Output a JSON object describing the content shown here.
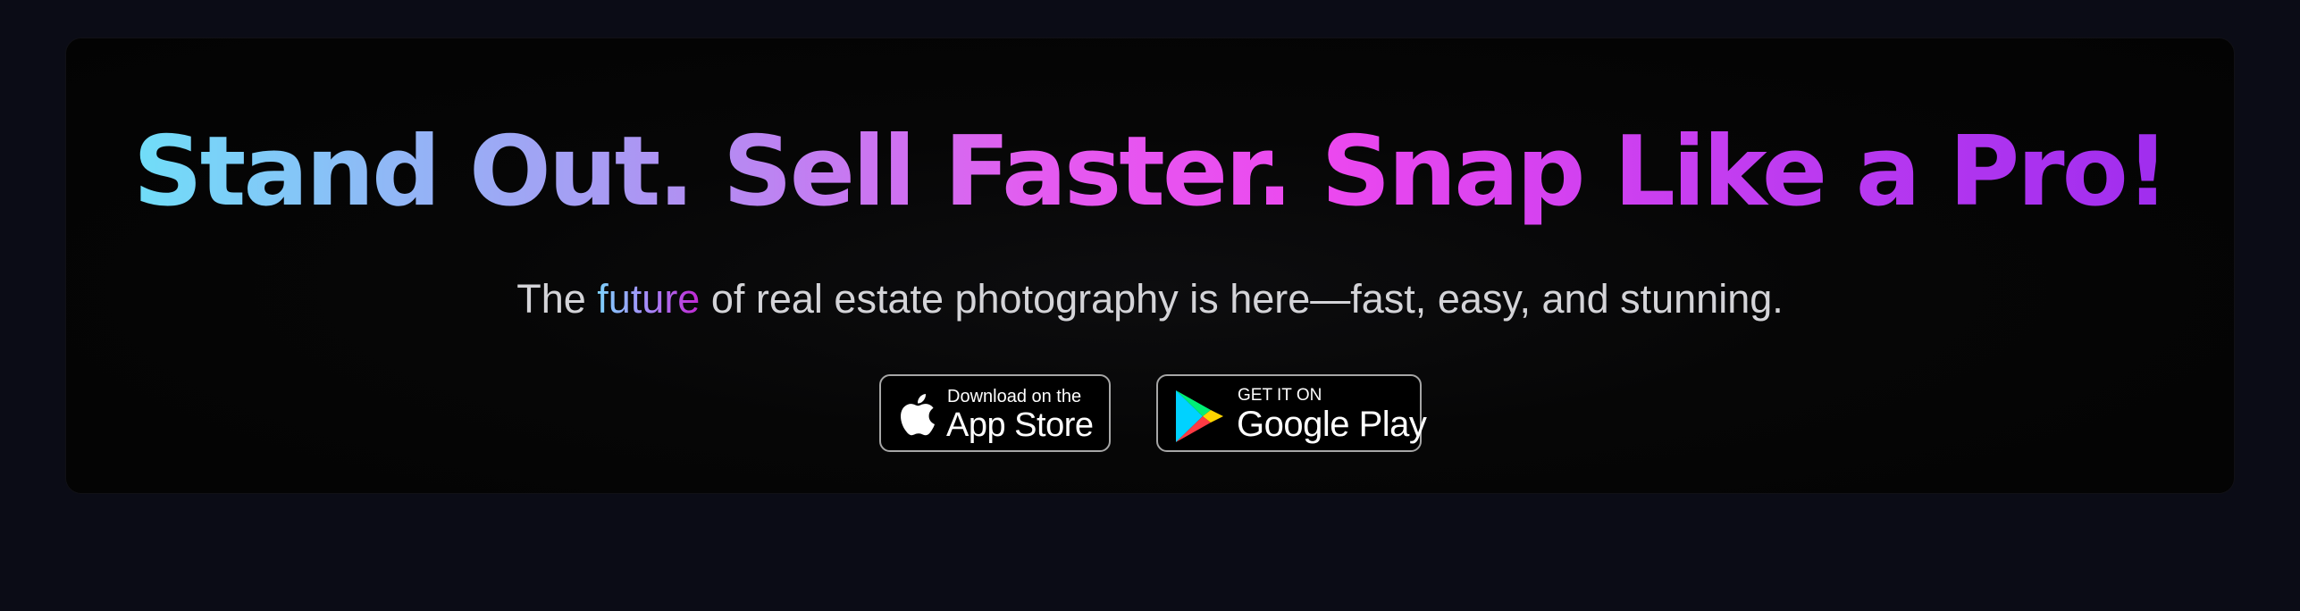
{
  "hero": {
    "headline": "Stand Out. Sell Faster. Snap Like a Pro!",
    "subtitle": {
      "before": "The ",
      "accent": "future",
      "after": " of real estate photography is here—fast, easy, and stunning."
    }
  },
  "badges": {
    "app_store": {
      "small": "Download on the",
      "big": "App Store",
      "icon": "apple-icon"
    },
    "google_play": {
      "small": "GET IT ON",
      "big": "Google Play",
      "icon": "google-play-icon"
    }
  },
  "colors": {
    "page_background": "#0b0c16",
    "card_background": "#050505",
    "headline_gradient": [
      "#67e8f9",
      "#b48cf2",
      "#ec48ef",
      "#9a2bee"
    ],
    "subtitle_text": "#d4d4d8",
    "badge_border": "#a6a6a6"
  }
}
